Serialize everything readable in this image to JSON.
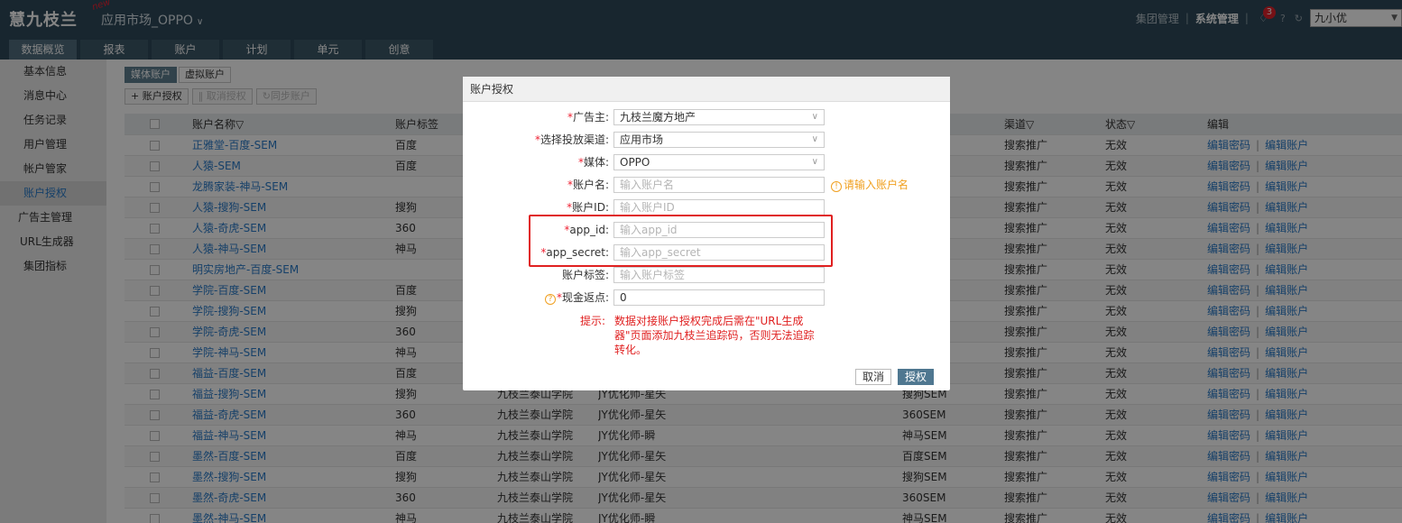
{
  "header": {
    "logo_text": "慧九枝兰",
    "new_badge": "new",
    "app_title": "应用市场_OPPO",
    "group_manage": "集团管理",
    "system_manage": "系统管理",
    "notification_count": "3",
    "user_name": "九小优"
  },
  "tabs": [
    {
      "label": "数据概览"
    },
    {
      "label": "报表"
    },
    {
      "label": "账户"
    },
    {
      "label": "计划"
    },
    {
      "label": "单元"
    },
    {
      "label": "创意"
    }
  ],
  "sidebar": {
    "items": [
      {
        "label": "基本信息"
      },
      {
        "label": "消息中心"
      },
      {
        "label": "任务记录"
      },
      {
        "label": "用户管理"
      },
      {
        "label": "帐户管家"
      },
      {
        "label": "账户授权"
      },
      {
        "label": "广告主管理"
      },
      {
        "label": "URL生成器"
      },
      {
        "label": "集团指标"
      }
    ]
  },
  "subtabs": [
    "媒体账户",
    "虚拟账户"
  ],
  "toolbar": {
    "authorize": "+ 账户授权",
    "cancel_authorize": "取消授权",
    "sync_account": "同步账户"
  },
  "table": {
    "headers": {
      "name": "账户名称",
      "tag": "账户标签",
      "channel": "渠道",
      "status": "状态",
      "edit": "编辑"
    },
    "edit_password": "编辑密码",
    "edit_account": "编辑账户",
    "rows": [
      {
        "name": "正雅堂-百度-SEM",
        "tag": "百度",
        "adv": "",
        "opt": "",
        "ch": "",
        "chl": "搜索推广",
        "st": "无效"
      },
      {
        "name": "人猿-SEM",
        "tag": "百度",
        "adv": "",
        "opt": "",
        "ch": "",
        "chl": "搜索推广",
        "st": "无效"
      },
      {
        "name": "龙腾家装-神马-SEM",
        "tag": "",
        "adv": "",
        "opt": "",
        "ch": "",
        "chl": "搜索推广",
        "st": "无效"
      },
      {
        "name": "人猿-搜狗-SEM",
        "tag": "搜狗",
        "adv": "",
        "opt": "",
        "ch": "",
        "chl": "搜索推广",
        "st": "无效"
      },
      {
        "name": "人猿-奇虎-SEM",
        "tag": "360",
        "adv": "",
        "opt": "",
        "ch": "",
        "chl": "搜索推广",
        "st": "无效"
      },
      {
        "name": "人猿-神马-SEM",
        "tag": "神马",
        "adv": "",
        "opt": "",
        "ch": "",
        "chl": "搜索推广",
        "st": "无效"
      },
      {
        "name": "明实房地产-百度-SEM",
        "tag": "",
        "adv": "",
        "opt": "",
        "ch": "",
        "chl": "搜索推广",
        "st": "无效"
      },
      {
        "name": "学院-百度-SEM",
        "tag": "百度",
        "adv": "",
        "opt": "",
        "ch": "",
        "chl": "搜索推广",
        "st": "无效"
      },
      {
        "name": "学院-搜狗-SEM",
        "tag": "搜狗",
        "adv": "",
        "opt": "",
        "ch": "",
        "chl": "搜索推广",
        "st": "无效"
      },
      {
        "name": "学院-奇虎-SEM",
        "tag": "360",
        "adv": "",
        "opt": "",
        "ch": "",
        "chl": "搜索推广",
        "st": "无效"
      },
      {
        "name": "学院-神马-SEM",
        "tag": "神马",
        "adv": "",
        "opt": "",
        "ch": "",
        "chl": "搜索推广",
        "st": "无效"
      },
      {
        "name": "福益-百度-SEM",
        "tag": "百度",
        "adv": "",
        "opt": "",
        "ch": "",
        "chl": "搜索推广",
        "st": "无效"
      },
      {
        "name": "福益-搜狗-SEM",
        "tag": "搜狗",
        "adv": "九枝兰泰山学院",
        "opt": "JY优化师-星矢",
        "ch": "搜狗SEM",
        "chl": "搜索推广",
        "st": "无效"
      },
      {
        "name": "福益-奇虎-SEM",
        "tag": "360",
        "adv": "九枝兰泰山学院",
        "opt": "JY优化师-星矢",
        "ch": "360SEM",
        "chl": "搜索推广",
        "st": "无效"
      },
      {
        "name": "福益-神马-SEM",
        "tag": "神马",
        "adv": "九枝兰泰山学院",
        "opt": "JY优化师-瞬",
        "ch": "神马SEM",
        "chl": "搜索推广",
        "st": "无效"
      },
      {
        "name": "墨然-百度-SEM",
        "tag": "百度",
        "adv": "九枝兰泰山学院",
        "opt": "JY优化师-星矢",
        "ch": "百度SEM",
        "chl": "搜索推广",
        "st": "无效"
      },
      {
        "name": "墨然-搜狗-SEM",
        "tag": "搜狗",
        "adv": "九枝兰泰山学院",
        "opt": "JY优化师-星矢",
        "ch": "搜狗SEM",
        "chl": "搜索推广",
        "st": "无效"
      },
      {
        "name": "墨然-奇虎-SEM",
        "tag": "360",
        "adv": "九枝兰泰山学院",
        "opt": "JY优化师-星矢",
        "ch": "360SEM",
        "chl": "搜索推广",
        "st": "无效"
      },
      {
        "name": "墨然-神马-SEM",
        "tag": "神马",
        "adv": "九枝兰泰山学院",
        "opt": "JY优化师-瞬",
        "ch": "神马SEM",
        "chl": "搜索推广",
        "st": "无效"
      }
    ]
  },
  "modal": {
    "title": "账户授权",
    "fields": {
      "advertiser": {
        "label": "广告主:",
        "value": "九枝兰魔方地产"
      },
      "channel": {
        "label": "选择投放渠道:",
        "value": "应用市场"
      },
      "media": {
        "label": "媒体:",
        "value": "OPPO"
      },
      "account_name": {
        "label": "账户名:",
        "placeholder": "输入账户名",
        "hint": "请输入账户名"
      },
      "account_id": {
        "label": "账户ID:",
        "placeholder": "输入账户ID"
      },
      "app_id": {
        "label": "app_id:",
        "placeholder": "输入app_id"
      },
      "app_secret": {
        "label": "app_secret:",
        "placeholder": "输入app_secret"
      },
      "account_tag": {
        "label": "账户标签:",
        "placeholder": "输入账户标签"
      },
      "cashback": {
        "label": "现金返点:",
        "value": "0"
      }
    },
    "tip_label": "提示:",
    "tip_text": "数据对接账户授权完成后需在\"URL生成器\"页面添加九枝兰追踪码，否则无法追踪转化。",
    "cancel": "取消",
    "confirm": "授权"
  }
}
